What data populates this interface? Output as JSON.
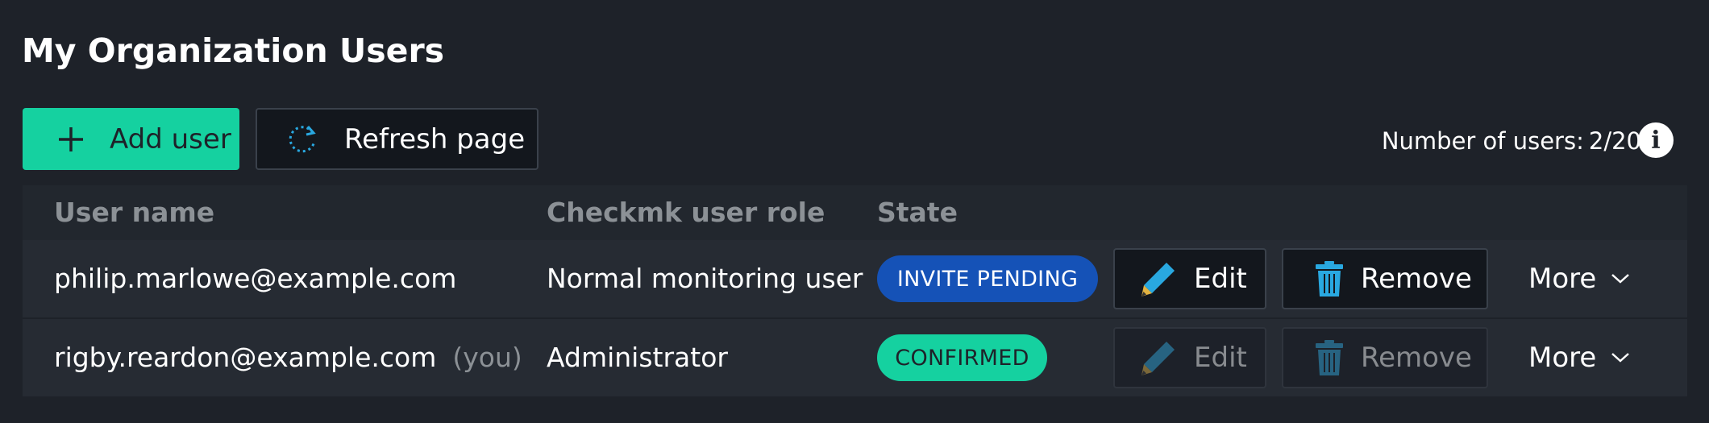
{
  "page": {
    "title": "My Organization Users"
  },
  "toolbar": {
    "add_label": "Add user",
    "refresh_label": "Refresh page",
    "count_label": "Number of users:",
    "count_value": "2/20"
  },
  "table": {
    "headers": [
      "User name",
      "Checkmk user role",
      "State"
    ],
    "rows": [
      {
        "username": "philip.marlowe@example.com",
        "you": "",
        "role": "Normal monitoring user",
        "state": "INVITE PENDING",
        "edit": "Edit",
        "remove": "Remove",
        "more": "More"
      },
      {
        "username": "rigby.reardon@example.com",
        "you": "(you)",
        "role": "Administrator",
        "state": "CONFIRMED",
        "edit": "Edit",
        "remove": "Remove",
        "more": "More"
      }
    ]
  },
  "colors": {
    "accent": "#15d1a0",
    "pending": "#1552b7",
    "background": "#1e2229",
    "icon_blue": "#29a8e0"
  },
  "icons": [
    "plus-icon",
    "refresh-icon",
    "info-icon",
    "pencil-icon",
    "trash-icon",
    "chevron-down-icon"
  ]
}
